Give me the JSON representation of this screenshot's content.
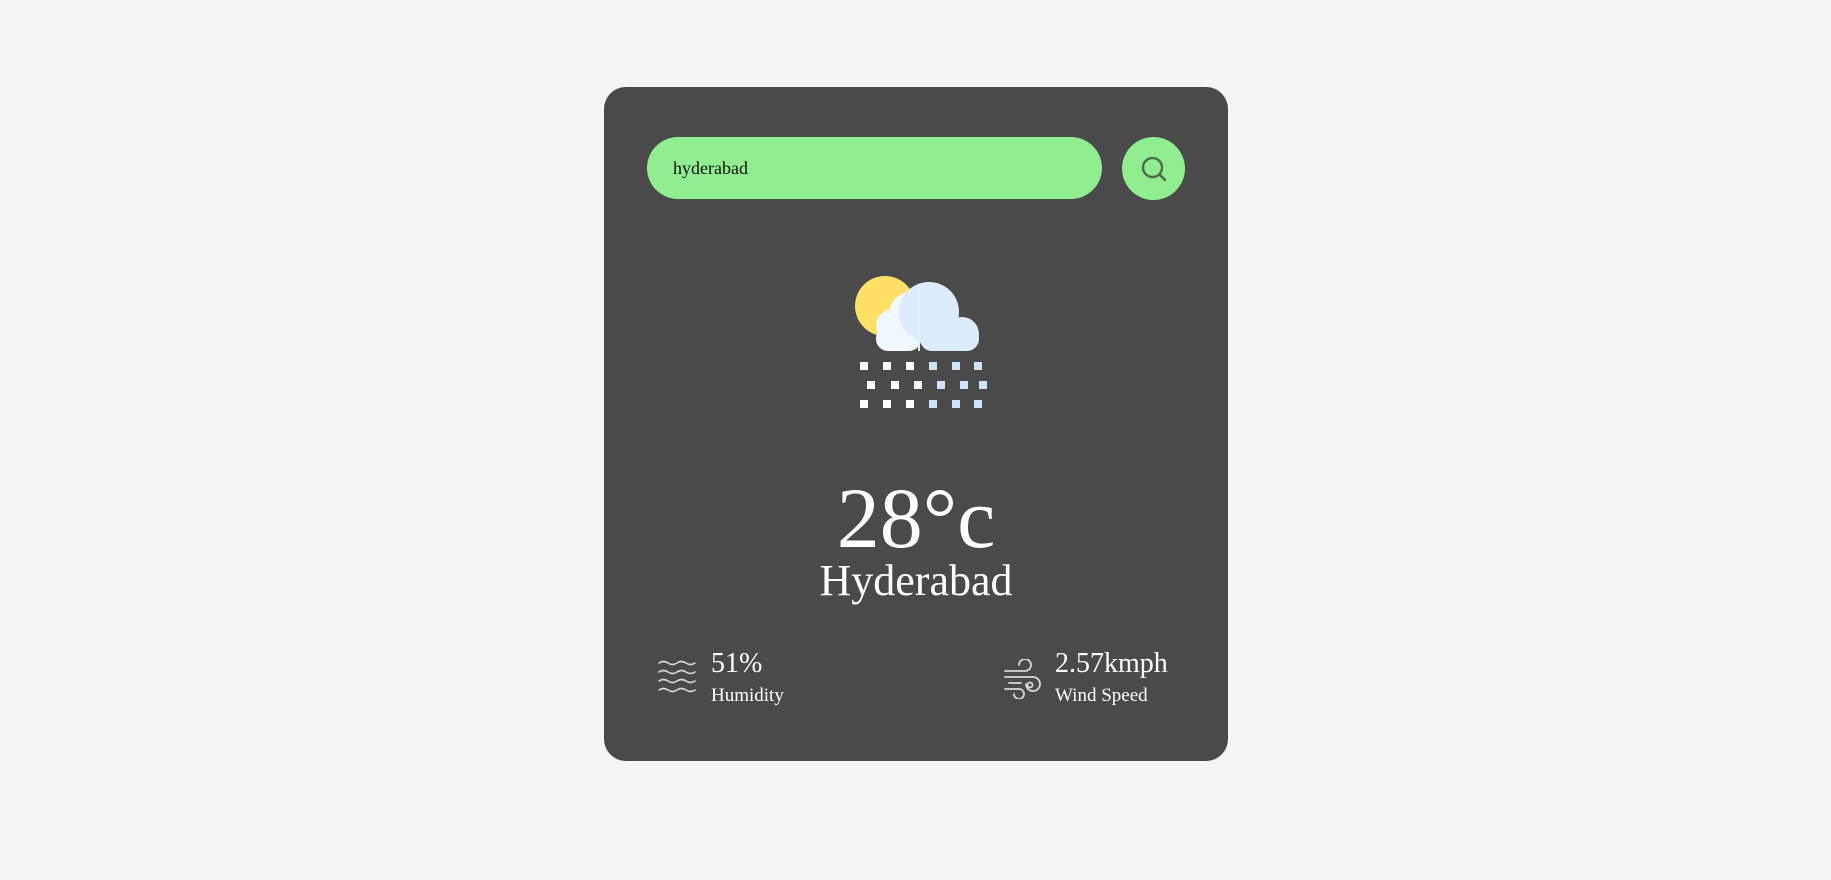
{
  "search": {
    "value": "hyderabad",
    "placeholder": ""
  },
  "weather": {
    "icon": "sun-cloud-snow-icon",
    "temperature": "28°c",
    "city": "Hyderabad"
  },
  "humidity": {
    "icon": "humidity-waves-icon",
    "value": "51%",
    "label": "Humidity"
  },
  "wind": {
    "icon": "wind-icon",
    "value": "2.57kmph",
    "label": "Wind Speed"
  },
  "colors": {
    "background": "#f5f5f5",
    "card": "#4a4a4a",
    "accent": "#90ee90",
    "text": "#ffffff"
  }
}
